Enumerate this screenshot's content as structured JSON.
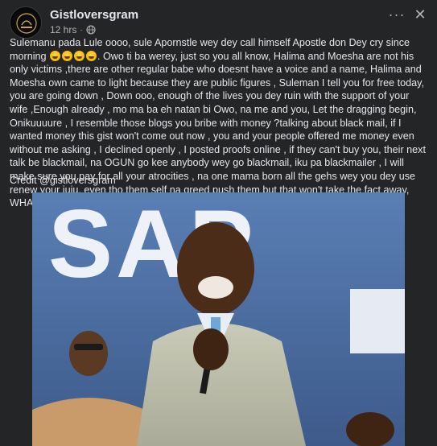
{
  "post": {
    "author": "Gistloversgram",
    "time": "12 hrs",
    "separator": "·",
    "caption_parts": [
      "Sulemanu pada Lule oooo, sule Apornstle wey dey call himself Apostle don Dey cry since morning ",
      ". Owo ti ba werey, just so you all know, Halima and Moesha are  not his only victims ,there are other regular babe who doesnt have a voice and a name, Halima and Moesha own came to light because they are public figures , Suleman I tell you for free today, you are going down , Down ooo, enough of the lives you dey ruin with the support of your wife ,Enough already , mo ma ba eh natan bi Owo, na me and you, Let the dragging begin, Onikuuuure , I resemble those blogs you bribe with money ?talking about black mail, if I wanted money this gist won't come out now , you and your people offered me money even without me asking , I declined openly , I posted proofs online , if they can't buy you, their next talk be blackmail, na OGUN go kee anybody wey go blackmail, iku pa blackmailer ,  I will make sure you pay for all your atrocities , na one mama born all the gehs wey you dey use renew your juju, even tho them self na greed push them but that won't take the fact away, WHAT IS WRONG IS WRONG"
    ],
    "credit": "Credit @gistloversgram",
    "video_backdrop_text": "SAP",
    "icons": {
      "avatar": "page-avatar-icon",
      "privacy": "globe-icon",
      "more": "more-options-icon",
      "close": "close-icon",
      "emoji": "laughing-crying-emoji-icon"
    },
    "colors": {
      "background": "#242526",
      "text": "#e4e6eb",
      "secondary_text": "#b0b3b8"
    }
  }
}
